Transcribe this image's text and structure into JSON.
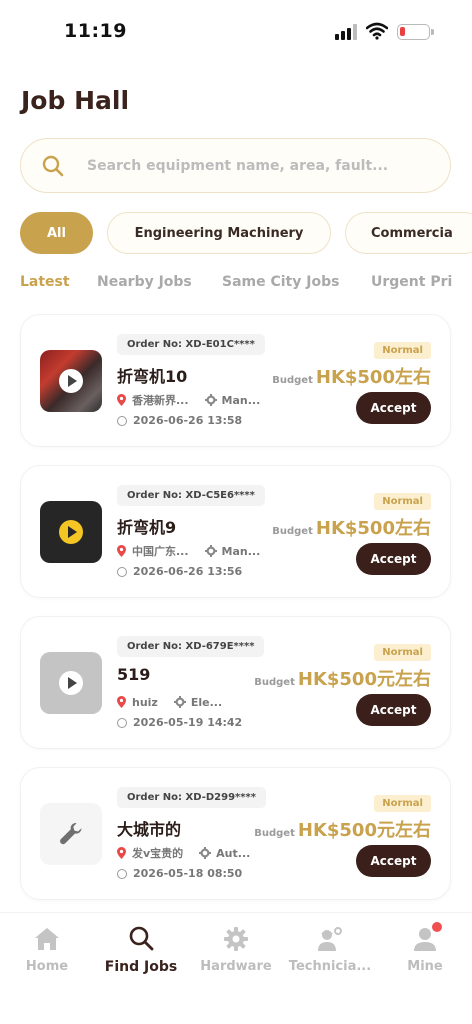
{
  "status_bar": {
    "time": "11:19",
    "battery_level": 0.2
  },
  "title": "Job Hall",
  "search": {
    "placeholder": "Search equipment name, area, fault..."
  },
  "categories": [
    {
      "label": "All",
      "active": true
    },
    {
      "label": "Engineering Machinery",
      "active": false
    },
    {
      "label": "Commercia",
      "active": false
    }
  ],
  "tabs": [
    {
      "label": "Latest",
      "active": true
    },
    {
      "label": "Nearby Jobs",
      "active": false
    },
    {
      "label": "Same City Jobs",
      "active": false
    },
    {
      "label": "Urgent Pri",
      "active": false
    }
  ],
  "jobs": [
    {
      "order": "Order No: XD-E01C****",
      "status": "Normal",
      "title": "折弯机10",
      "budget_label": "Budget",
      "budget": "HK$500左右",
      "location": "香港新界...",
      "category": "Man...",
      "datetime": "2026-06-26 13:58",
      "accept": "Accept",
      "thumb": "photo"
    },
    {
      "order": "Order No: XD-C5E6****",
      "status": "Normal",
      "title": "折弯机9",
      "budget_label": "Budget",
      "budget": "HK$500左右",
      "location": "中国广东...",
      "category": "Man...",
      "datetime": "2026-06-26 13:56",
      "accept": "Accept",
      "thumb": "dark"
    },
    {
      "order": "Order No: XD-679E****",
      "status": "Normal",
      "title": "519",
      "budget_label": "Budget",
      "budget": "HK$500元左右",
      "location": "huiz",
      "category": "Ele...",
      "datetime": "2026-05-19 14:42",
      "accept": "Accept",
      "thumb": "gray"
    },
    {
      "order": "Order No: XD-D299****",
      "status": "Normal",
      "title": "大城市的",
      "budget_label": "Budget",
      "budget": "HK$500元左右",
      "location": "发v宝贵的",
      "category": "Aut...",
      "datetime": "2026-05-18 08:50",
      "accept": "Accept",
      "thumb": "light"
    }
  ],
  "nav": [
    {
      "label": "Home",
      "icon": "home-icon",
      "active": false
    },
    {
      "label": "Find Jobs",
      "icon": "search-icon",
      "active": true
    },
    {
      "label": "Hardware",
      "icon": "gear-icon",
      "active": false
    },
    {
      "label": "Technicia...",
      "icon": "technician-icon",
      "active": false
    },
    {
      "label": "Mine",
      "icon": "user-icon",
      "active": false,
      "badge": true
    }
  ],
  "colors": {
    "accent": "#c9a24e",
    "dark": "#3a1f1a",
    "badge_bg": "#fcefd0"
  }
}
